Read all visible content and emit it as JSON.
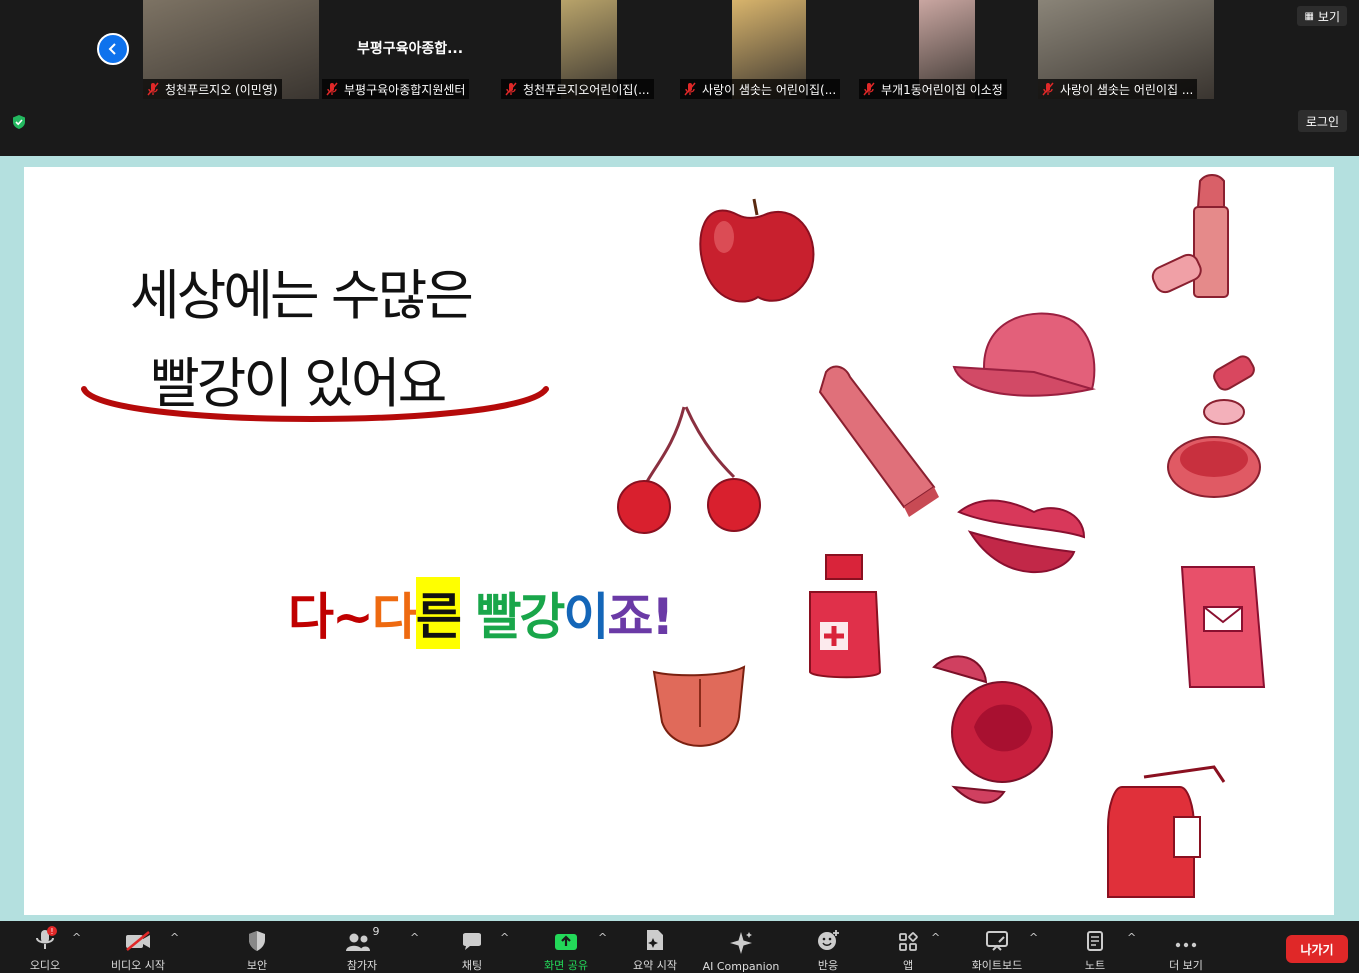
{
  "gallery": {
    "tiles": [
      {
        "name": "청천푸르지오 (이민영)",
        "has_video": true,
        "video_color": "#7d7364"
      },
      {
        "name": "부평구육아종합지원센터",
        "has_video": false,
        "center_label": "부평구육아종합..."
      },
      {
        "name": "청천푸르지오어린이집(...",
        "has_video": true,
        "video_color": "#b8a36a"
      },
      {
        "name": "사랑이 샘솟는 어린이집(...",
        "has_video": true,
        "video_color": "#d8b46c"
      },
      {
        "name": "부개1동어린이집 이소정",
        "has_video": true,
        "video_color": "#c9a6a1"
      },
      {
        "name": "사랑이 샘솟는 어린이집 ...",
        "has_video": true,
        "video_color": "#8a8478"
      }
    ],
    "view_label": "보기",
    "login_label": "로그인"
  },
  "slide": {
    "title_line1": "세상에는 수많은",
    "title_line2": "빨강이 있어요",
    "rainbow_chars": [
      {
        "ch": "다",
        "color": "#c00000",
        "highlight": false
      },
      {
        "ch": "~",
        "color": "#c00000",
        "highlight": false
      },
      {
        "ch": "다",
        "color": "#ee6a10",
        "highlight": false
      },
      {
        "ch": "른",
        "color": "#111111",
        "highlight": true
      },
      {
        "ch": " ",
        "color": "#111111",
        "highlight": false
      },
      {
        "ch": "빨",
        "color": "#19a64a",
        "highlight": false
      },
      {
        "ch": "강",
        "color": "#19a64a",
        "highlight": false
      },
      {
        "ch": "이",
        "color": "#1466b8",
        "highlight": false
      },
      {
        "ch": "죠",
        "color": "#6a3aa6",
        "highlight": false
      },
      {
        "ch": "!",
        "color": "#6a3aa6",
        "highlight": false
      }
    ]
  },
  "toolbar": {
    "audio": "오디오",
    "video": "비디오 시작",
    "security": "보안",
    "participants": "참가자",
    "participant_count": "9",
    "chat": "채팅",
    "share": "화면 공유",
    "summary": "요약 시작",
    "ai": "AI Companion",
    "reactions": "반응",
    "apps": "앱",
    "whiteboard": "화이트보드",
    "notes": "노트",
    "more": "더 보기",
    "leave": "나가기"
  },
  "colors": {
    "accent_blue": "#0e72ed",
    "share_green": "#23d959",
    "leave_red": "#e02828",
    "share_border": "#b4e0df"
  }
}
